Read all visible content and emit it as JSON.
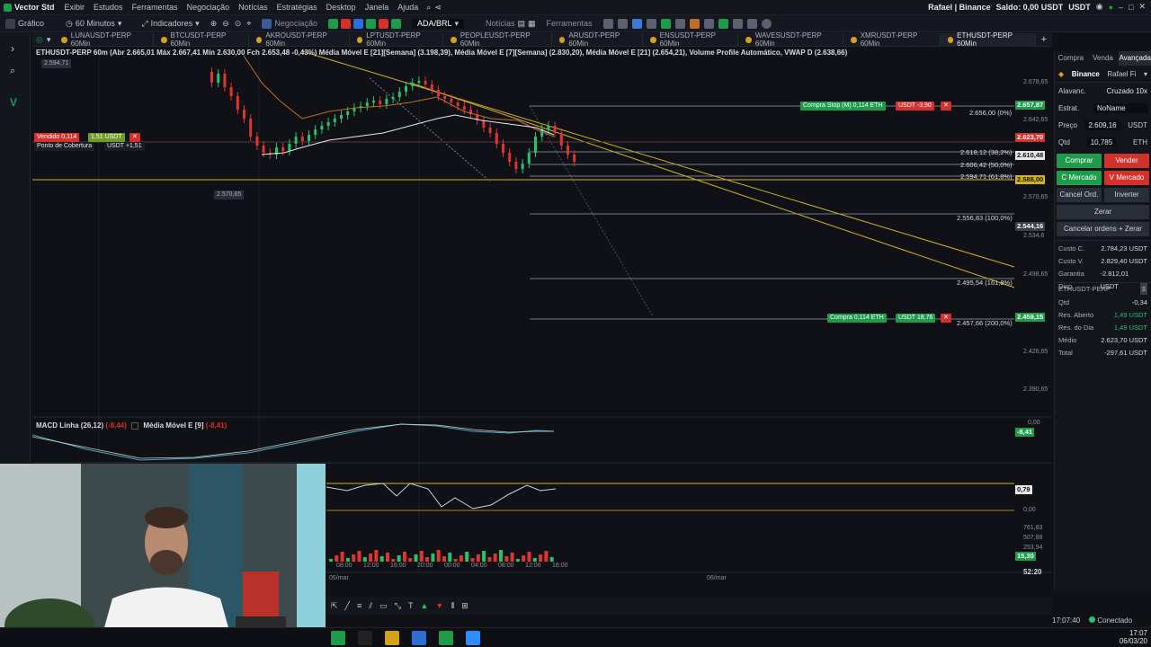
{
  "menubar": {
    "app_name": "Vector Std",
    "menus": [
      "Exibir",
      "Estudos",
      "Ferramentas",
      "Negociação",
      "Notícias",
      "Estratégias",
      "Desktop",
      "Janela",
      "Ajuda"
    ],
    "account": "Rafael | Binance",
    "balance": "Saldo: 0,00 USDT",
    "currency": "USDT"
  },
  "toolbar": {
    "chart_label": "Gráfico",
    "timeframe": "60 Minutos",
    "indicators": "Indicadores",
    "negotiation": "Negociação",
    "symbol": "ADA/BRL",
    "news": "Notícias",
    "tools": "Ferramentas"
  },
  "tabs": [
    {
      "label": "LUNAUSDT-PERP 60Min",
      "active": false
    },
    {
      "label": "BTCUSDT-PERP 60Min",
      "active": false
    },
    {
      "label": "AKROUSDT-PERP 60Min",
      "active": false
    },
    {
      "label": "LPTUSDT-PERP 60Min",
      "active": false
    },
    {
      "label": "PEOPLEUSDT-PERP 60Min",
      "active": false
    },
    {
      "label": "ARUSDT-PERP 60Min",
      "active": false
    },
    {
      "label": "ENSUSDT-PERP 60Min",
      "active": false
    },
    {
      "label": "WAVESUSDT-PERP 60Min",
      "active": false
    },
    {
      "label": "XMRUSDT-PERP 60Min",
      "active": false
    },
    {
      "label": "ETHUSDT-PERP 60Min",
      "active": true
    }
  ],
  "legend": {
    "text": "ETHUSDT-PERP 60m (Abr 2.665,01 Máx 2.667,41 Mín 2.630,00 Fch 2.653,48 -0,43%) Média Móvel E [21][Semana] (3.198,39), Média Móvel E [7][Semana] (2.830,20), Média Móvel E [21] (2.654,21), Volume Profile Automático, VWAP D (2.638,66)",
    "hi_label": "2.594,71",
    "lo_label": "2.570,65"
  },
  "orders": {
    "sold": "Vendido 0,114",
    "sold_pnl": "1,51 USDT",
    "cover": "Ponto de Cobertura",
    "cover_pnl": "USDT +1,51",
    "stop_buy": "Compra Stop (M) 0,114 ETH",
    "stop_buy_pnl": "USDT -3,90",
    "buy": "Compra 0,114 ETH",
    "buy_pnl": "USDT 18,76"
  },
  "fib_levels": [
    {
      "label": "2.656,00 (0%)"
    },
    {
      "label": "2.618,12 (38,2%)"
    },
    {
      "label": "2.606,42 (50,0%)"
    },
    {
      "label": "2.594,71 (61,8%)"
    },
    {
      "label": "2.556,83 (100,0%)"
    },
    {
      "label": "2.495,54 (161,8%)"
    },
    {
      "label": "2.457,66 (200,0%)"
    }
  ],
  "price_axis": [
    "2.678,65",
    "2.642,65",
    "2.570,65",
    "2.534,6",
    "2.498,65",
    "2.426,65",
    "2.390,65"
  ],
  "price_tags": [
    {
      "label": "2.657,87",
      "color": "#1e9b4b"
    },
    {
      "label": "2.623,70",
      "color": "#d3312b"
    },
    {
      "label": "2.610,48",
      "color": "#e6e6e6"
    },
    {
      "label": "2.588,00",
      "color": "#d4b21a"
    },
    {
      "label": "2.544,16",
      "color": "#3a3f4a"
    },
    {
      "label": "2.459,15",
      "color": "#1e9b4b"
    }
  ],
  "macd": {
    "label": "MACD Linha (26,12)",
    "value": "(-8,44)",
    "ma_label": "Média Móvel E [9]",
    "ma_value": "(-8,41)",
    "zero": "0,00",
    "tag": "-8,41"
  },
  "osc": {
    "tag": "0,79",
    "zero": "0,00"
  },
  "volume": {
    "v1": "761,83",
    "v2": "507,88",
    "v3": "253,94",
    "tag": "15,30"
  },
  "time_axis": [
    "08:00",
    "12:00",
    "16:00",
    "20:00",
    "00:00",
    "04:00",
    "08:00",
    "12:00",
    "16:00"
  ],
  "date_axis": [
    "05/mar",
    "06/mar"
  ],
  "countdown": "52:20",
  "right_panel": {
    "tabs": [
      "Compra",
      "Venda",
      "Avançada"
    ],
    "exchange": "Binance",
    "account": "Rafael Fi",
    "leverage_label": "Alavanc.",
    "leverage_value": "Cruzado 10x",
    "strategy_label": "Estrat.",
    "strategy_value": "NoName",
    "price_label": "Preço",
    "price_value": "2.609,16",
    "price_unit": "USDT",
    "qty_label": "Qtd",
    "qty_value": "10,785",
    "qty_unit": "ETH",
    "buy": "Comprar",
    "sell": "Vender",
    "buy_market": "C Mercado",
    "sell_market": "V Mercado",
    "cancel": "Cancel Ord.",
    "invert": "Inverter",
    "zero": "Zerar",
    "cancel_zero": "Cancelar ordens + Zerar",
    "stats": [
      {
        "k": "Custo C.",
        "v": "2.784,23 USDT"
      },
      {
        "k": "Custo V.",
        "v": "2.829,40 USDT"
      },
      {
        "k": "Garantia Disp.",
        "v": "-2.812,01 USDT"
      }
    ],
    "symbol": "ETHUSDT-PERP",
    "pos": [
      {
        "k": "Qtd",
        "v": "-0,34"
      },
      {
        "k": "Res. Aberto",
        "v": "1,49 USDT"
      },
      {
        "k": "Res. do Dia",
        "v": "1,49 USDT"
      },
      {
        "k": "Médio",
        "v": "2.623,70 USDT"
      },
      {
        "k": "Total",
        "v": "-297,61 USDT"
      }
    ]
  },
  "status": {
    "time": "17:07:40",
    "connected": "Conectado"
  },
  "clock": {
    "time": "17:07",
    "date": "06/03/20"
  }
}
